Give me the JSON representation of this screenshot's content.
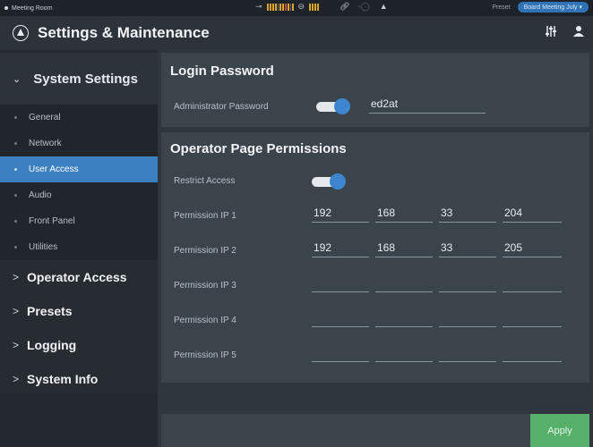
{
  "statusbar": {
    "room": "Meeting Room",
    "preset_label": "Preset",
    "preset_value": "Board Meeting July"
  },
  "header": {
    "title": "Settings & Maintenance"
  },
  "sidebar": {
    "expanded_section": "System Settings",
    "subitems": [
      "General",
      "Network",
      "User Access",
      "Audio",
      "Front Panel",
      "Utilities"
    ],
    "active_subitem": "User Access",
    "sections": [
      "Operator Access",
      "Presets",
      "Logging",
      "System Info"
    ]
  },
  "login": {
    "title": "Login Password",
    "label": "Administrator Password",
    "toggle_on": true,
    "value": "ed2at"
  },
  "operator": {
    "title": "Operator Page Permissions",
    "restrict_label": "Restrict Access",
    "restrict_on": true,
    "ips": [
      {
        "label": "Permission IP 1",
        "octets": [
          "192",
          "168",
          "33",
          "204"
        ]
      },
      {
        "label": "Permission IP 2",
        "octets": [
          "192",
          "168",
          "33",
          "205"
        ]
      },
      {
        "label": "Permission IP 3",
        "octets": [
          "",
          "",
          "",
          ""
        ]
      },
      {
        "label": "Permission IP 4",
        "octets": [
          "",
          "",
          "",
          ""
        ]
      },
      {
        "label": "Permission IP 5",
        "octets": [
          "",
          "",
          "",
          ""
        ]
      }
    ]
  },
  "footer": {
    "apply_label": "Apply"
  },
  "colors": {
    "accent": "#3d80c2",
    "apply": "#56b06a",
    "meter_green": "#e0a32a"
  },
  "icons": [
    "power-input-icon",
    "output-icon",
    "link-icon",
    "mute-icon",
    "warning-icon",
    "mixer-icon",
    "user-icon",
    "brand-logo-icon"
  ]
}
